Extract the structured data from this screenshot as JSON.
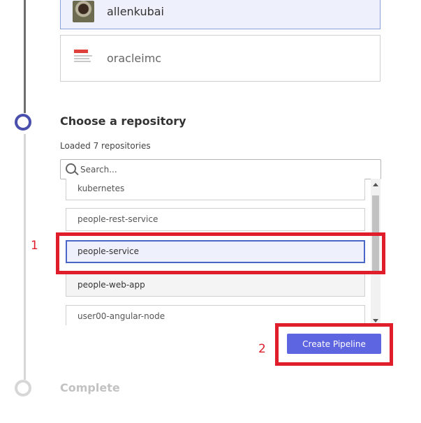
{
  "orgs": [
    {
      "name": "allenkubai",
      "selected": true,
      "icon": "avatar"
    },
    {
      "name": "oracleimc",
      "selected": false,
      "icon": "oracle-logo"
    }
  ],
  "steps": {
    "choose_repo": {
      "title": "Choose a repository",
      "status": "active"
    },
    "complete": {
      "title": "Complete",
      "status": "pending"
    }
  },
  "repos": {
    "loaded_text": "Loaded 7 repositories",
    "search_placeholder": "Search...",
    "items": [
      {
        "name": "kubernetes"
      },
      {
        "name": "people-rest-service"
      },
      {
        "name": "people-service",
        "selected": true
      },
      {
        "name": "people-web-app"
      },
      {
        "name": "user00-angular-node"
      }
    ]
  },
  "actions": {
    "create_label": "Create Pipeline"
  },
  "annotations": {
    "one": "1",
    "two": "2"
  },
  "colors": {
    "accent": "#5e65e0",
    "step_active": "#4a4fae",
    "highlight": "#e01d2a"
  }
}
